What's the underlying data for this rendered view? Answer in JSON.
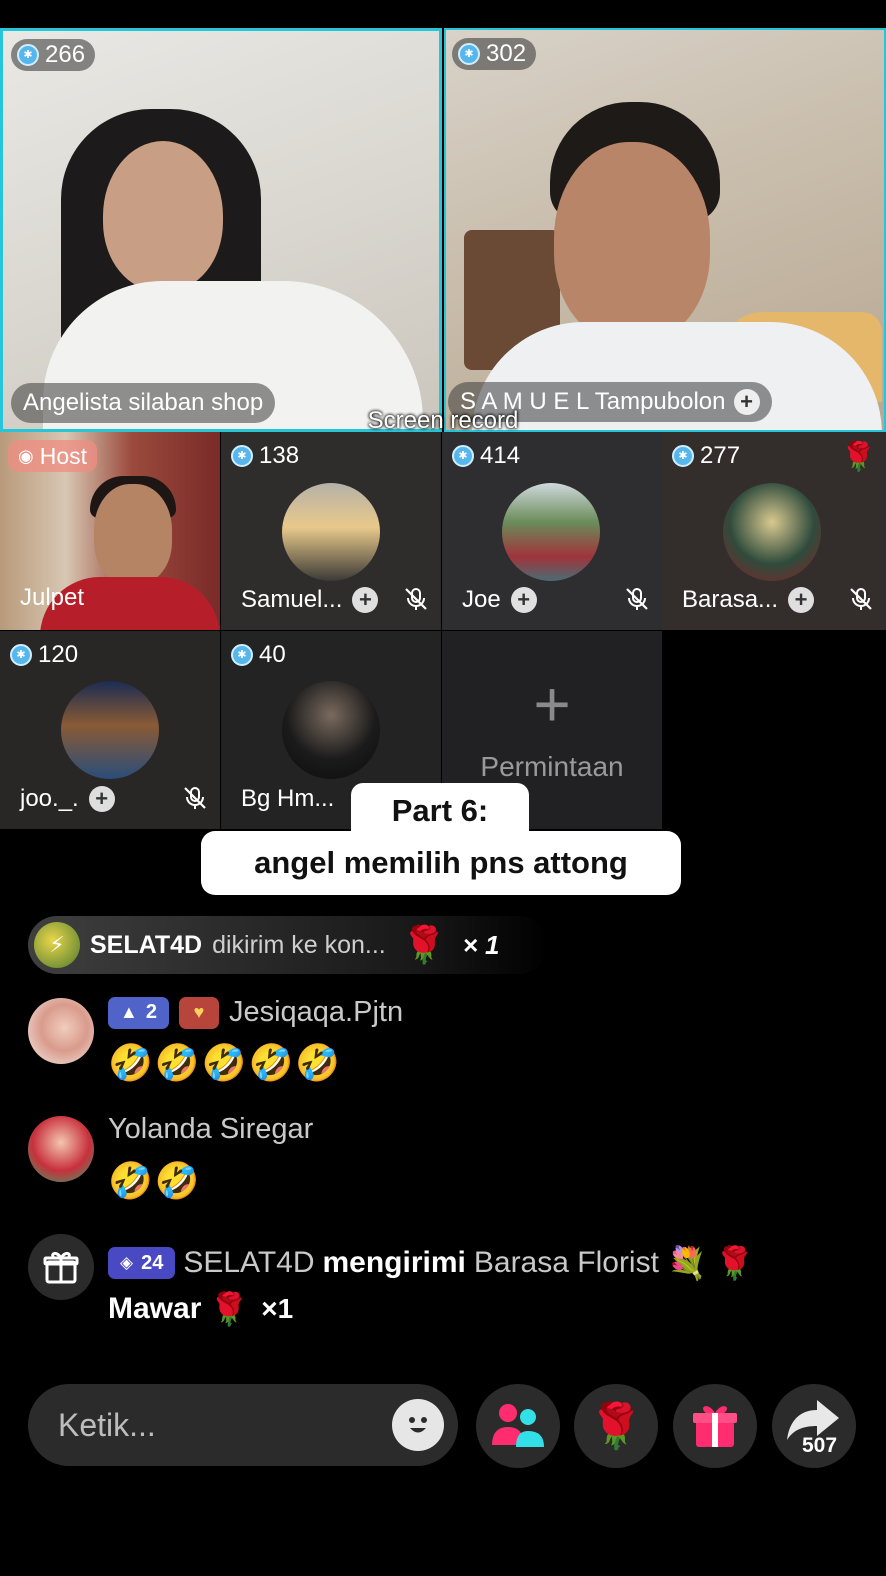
{
  "grid": {
    "tiles_large": [
      {
        "score": "266",
        "name": "Angelista silaban shop"
      },
      {
        "score": "302",
        "name": "S A M U E L Tampubolon"
      }
    ],
    "host": {
      "badge": "Host",
      "name": "Julpet"
    },
    "tiles_small": [
      {
        "score": "138",
        "name": "Samuel..."
      },
      {
        "score": "414",
        "name": "Joe"
      },
      {
        "score": "277",
        "name": "Barasa..."
      },
      {
        "score": "120",
        "name": "joo._."
      },
      {
        "score": "40",
        "name": "Bg Hm..."
      }
    ],
    "request_label": "Permintaan"
  },
  "overlay": {
    "screen_record": "Screen record",
    "caption_line1": "Part 6:",
    "caption_line2": "angel memilih pns attong"
  },
  "chat": {
    "gift_banner": {
      "user": "SELAT4D",
      "text": "dikirim ke kon...",
      "count": "× 1"
    },
    "messages": [
      {
        "level": "2",
        "name": "Jesiqaqa.Pjtn",
        "text": "🤣🤣🤣🤣🤣"
      },
      {
        "name": "Yolanda Siregar",
        "text": "🤣🤣"
      }
    ],
    "gift_event": {
      "level": "24",
      "sender": "SELAT4D",
      "verb": "mengirimi",
      "recipient": "Barasa Florist",
      "gift_name": "Mawar",
      "count": "×1"
    }
  },
  "bottom_bar": {
    "input_placeholder": "Ketik...",
    "share_count": "507"
  },
  "colors": {
    "tile_border": "#25c6d9",
    "level_badge": "#5063c8",
    "coin": "#57b7ec",
    "accent_pink": "#ff2d6f",
    "accent_cyan": "#34e0e8"
  }
}
